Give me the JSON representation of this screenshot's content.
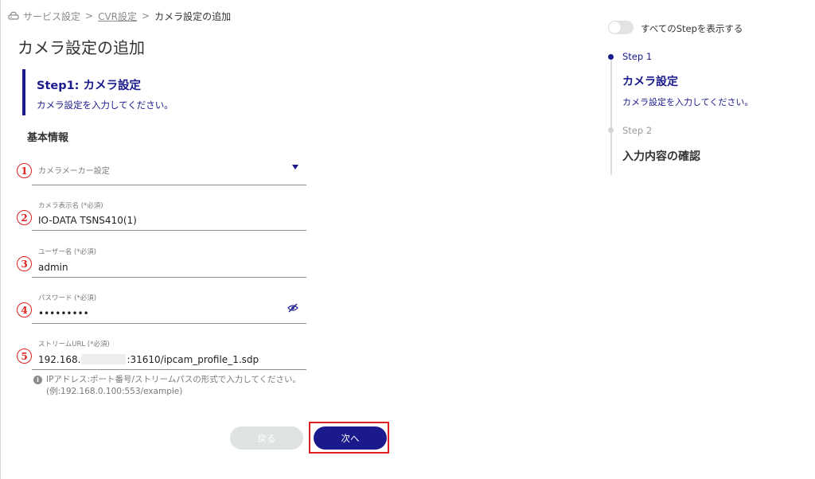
{
  "breadcrumb": {
    "home_icon": "router-icon",
    "items": [
      "サービス設定",
      "CVR設定",
      "カメラ設定の追加"
    ],
    "separator": ">"
  },
  "page": {
    "title": "カメラ設定の追加"
  },
  "step_header": {
    "title": "Step1: カメラ設定",
    "description": "カメラ設定を入力してください。"
  },
  "section": {
    "label": "基本情報"
  },
  "markers": [
    "1",
    "2",
    "3",
    "4",
    "5"
  ],
  "form": {
    "camera_maker": {
      "placeholder": "カメラメーカー設定",
      "icon": "dropdown-triangle-icon"
    },
    "display_name": {
      "label": "カメラ表示名 (*必須)",
      "value": "IO-DATA TSNS410(1)"
    },
    "username": {
      "label": "ユーザー名 (*必須)",
      "value": "admin"
    },
    "password": {
      "label": "パスワード (*必須)",
      "value": "•••••••••",
      "icon": "eye-off-icon"
    },
    "stream_url": {
      "label": "ストリームURL (*必須)",
      "value_prefix": "192.168.",
      "value_suffix": ":31610/ipcam_profile_1.sdp",
      "hint": "IPアドレス:ポート番号/ストリームパスの形式で入力してください。(例:192.168.0.100:553/example)"
    }
  },
  "buttons": {
    "back": "戻る",
    "next": "次へ"
  },
  "stepper": {
    "toggle_label": "すべてのStepを表示する",
    "steps": [
      {
        "label": "Step 1",
        "title": "カメラ設定",
        "description": "カメラ設定を入力してください。"
      },
      {
        "label": "Step 2",
        "title": "入力内容の確認"
      }
    ]
  },
  "colors": {
    "accent": "#1a1a8c",
    "annotation_red": "#e02020",
    "disabled_button": "#dfe3e3"
  }
}
